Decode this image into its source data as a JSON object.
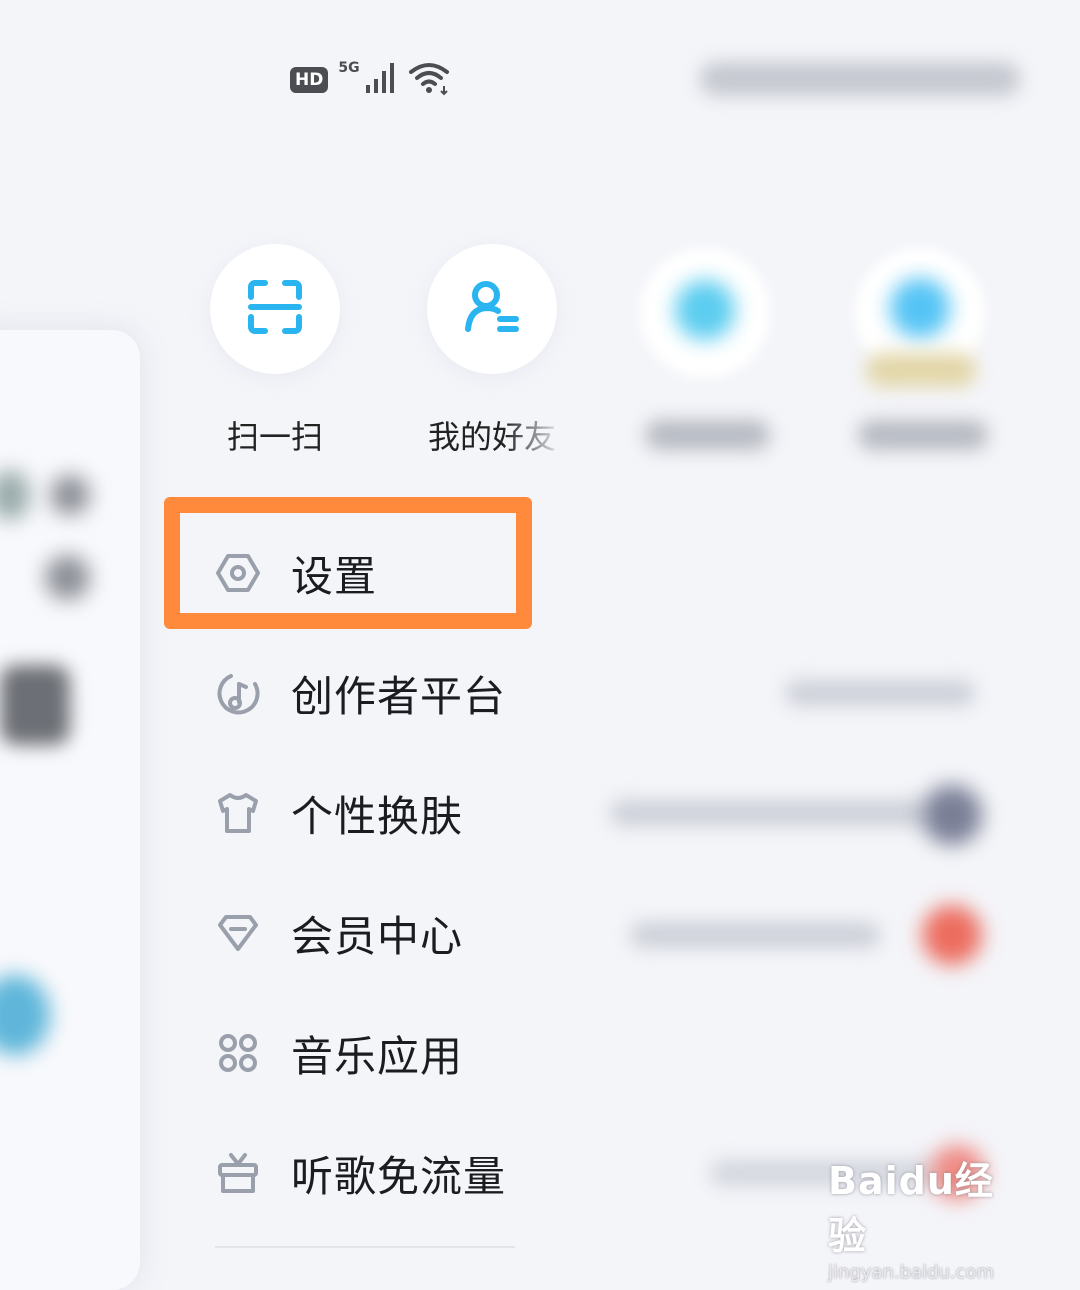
{
  "status_bar": {
    "hd": "HD",
    "network": "5G"
  },
  "quick_actions": [
    {
      "label": "扫一扫",
      "icon": "scan-icon"
    },
    {
      "label": "我的好友",
      "icon": "friends-icon"
    }
  ],
  "menu": [
    {
      "label": "设置",
      "icon": "settings-icon"
    },
    {
      "label": "创作者平台",
      "icon": "creator-icon"
    },
    {
      "label": "个性换肤",
      "icon": "tshirt-icon"
    },
    {
      "label": "会员中心",
      "icon": "diamond-icon"
    },
    {
      "label": "音乐应用",
      "icon": "apps-grid-icon"
    },
    {
      "label": "听歌免流量",
      "icon": "gift-icon"
    }
  ],
  "watermark": {
    "brand": "Baidu经验",
    "url": "jingyan.baidu.com"
  },
  "colors": {
    "accent_blue": "#2ab4f0",
    "highlight_orange": "#ff8a3c",
    "icon_gray": "#9aa0ab"
  }
}
